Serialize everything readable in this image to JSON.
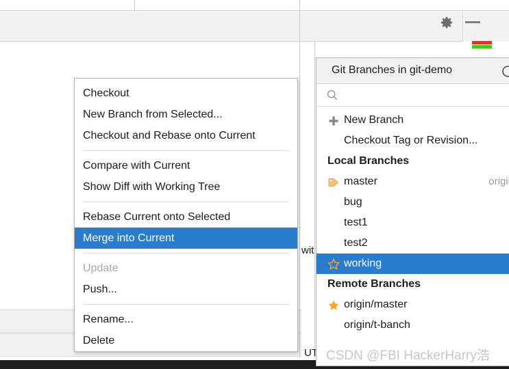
{
  "toolbar": {
    "gear_icon": "gear-icon",
    "minimize_icon": "minimize-icon"
  },
  "background": {
    "fragment_with": "wit",
    "fragment_ut": "UT"
  },
  "context_menu": {
    "groups": [
      {
        "items": [
          {
            "label": "Checkout",
            "state": "normal"
          },
          {
            "label": "New Branch from Selected...",
            "state": "normal"
          },
          {
            "label": "Checkout and Rebase onto Current",
            "state": "normal"
          }
        ]
      },
      {
        "items": [
          {
            "label": "Compare with Current",
            "state": "normal"
          },
          {
            "label": "Show Diff with Working Tree",
            "state": "normal"
          }
        ]
      },
      {
        "items": [
          {
            "label": "Rebase Current onto Selected",
            "state": "normal"
          },
          {
            "label": "Merge into Current",
            "state": "selected"
          }
        ]
      },
      {
        "items": [
          {
            "label": "Update",
            "state": "disabled"
          },
          {
            "label": "Push...",
            "state": "normal"
          }
        ]
      },
      {
        "items": [
          {
            "label": "Rename...",
            "state": "normal"
          },
          {
            "label": "Delete",
            "state": "normal"
          }
        ]
      }
    ]
  },
  "branches_panel": {
    "title": "Git Branches in git-demo",
    "refresh_icon": "refresh-icon",
    "search": {
      "value": "",
      "placeholder": "",
      "icon": "search-icon"
    },
    "actions": [
      {
        "label": "New Branch",
        "icon": "plus-icon"
      },
      {
        "label": "Checkout Tag or Revision...",
        "icon": "none"
      }
    ],
    "local_branches_header": "Local Branches",
    "local_branches": [
      {
        "label": "master",
        "icon": "tag-icon",
        "tracking": "origin/ma",
        "selected": false
      },
      {
        "label": "bug",
        "icon": "none",
        "tracking": "",
        "selected": false
      },
      {
        "label": "test1",
        "icon": "none",
        "tracking": "",
        "selected": false
      },
      {
        "label": "test2",
        "icon": "none",
        "tracking": "",
        "selected": false
      },
      {
        "label": "working",
        "icon": "star-outline-icon",
        "tracking": "",
        "selected": true
      }
    ],
    "remote_branches_header": "Remote Branches",
    "remote_branches": [
      {
        "label": "origin/master",
        "icon": "star-filled-icon",
        "selected": false
      },
      {
        "label": "origin/t-banch",
        "icon": "none",
        "selected": false
      }
    ]
  },
  "watermark": {
    "text": "CSDN @FBI HackerHarry浩"
  },
  "colors": {
    "selection_blue": "#2a7cce",
    "accent_orange": "#f5a623",
    "panel_gray": "#f2f2f2",
    "disabled_gray": "#a8a8a8"
  }
}
